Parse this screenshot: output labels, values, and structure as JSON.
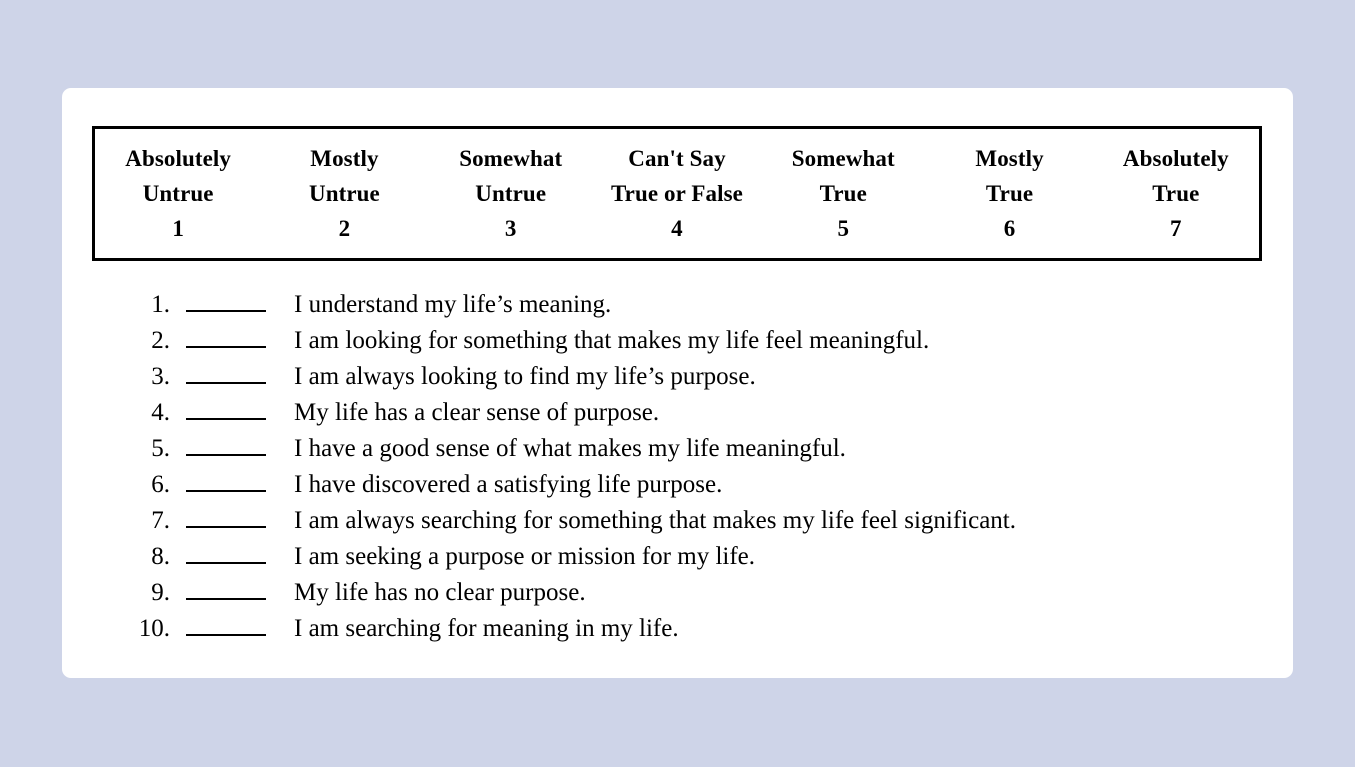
{
  "document": {
    "background_color": "#ced4e8",
    "card_color": "#ffffff",
    "text_color": "#000000",
    "border_color": "#000000"
  },
  "scale": {
    "anchors": [
      {
        "line1": "Absolutely",
        "line2": "Untrue",
        "value": "1"
      },
      {
        "line1": "Mostly",
        "line2": "Untrue",
        "value": "2"
      },
      {
        "line1": "Somewhat",
        "line2": "Untrue",
        "value": "3"
      },
      {
        "line1": "Can't Say",
        "line2": "True or False",
        "value": "4"
      },
      {
        "line1": "Somewhat",
        "line2": "True",
        "value": "5"
      },
      {
        "line1": "Mostly",
        "line2": "True",
        "value": "6"
      },
      {
        "line1": "Absolutely",
        "line2": "True",
        "value": "7"
      }
    ]
  },
  "items": [
    {
      "number": "1.",
      "blank": "",
      "text": "I understand my life’s meaning."
    },
    {
      "number": "2.",
      "blank": "",
      "text": "I am looking for something that makes my life feel meaningful."
    },
    {
      "number": "3.",
      "blank": "",
      "text": "I am always looking to find my life’s purpose."
    },
    {
      "number": "4.",
      "blank": "",
      "text": "My life has a clear sense of purpose."
    },
    {
      "number": "5.",
      "blank": "",
      "text": "I have a good sense of what makes my life meaningful."
    },
    {
      "number": "6.",
      "blank": "",
      "text": "I have discovered a satisfying life purpose."
    },
    {
      "number": "7.",
      "blank": "",
      "text": "I am always searching for something that makes my life feel significant."
    },
    {
      "number": "8.",
      "blank": "",
      "text": "I am seeking a purpose or mission for my life."
    },
    {
      "number": "9.",
      "blank": "",
      "text": "My life has no clear purpose."
    },
    {
      "number": "10.",
      "blank": "",
      "text": "I am searching for meaning in my life."
    }
  ]
}
